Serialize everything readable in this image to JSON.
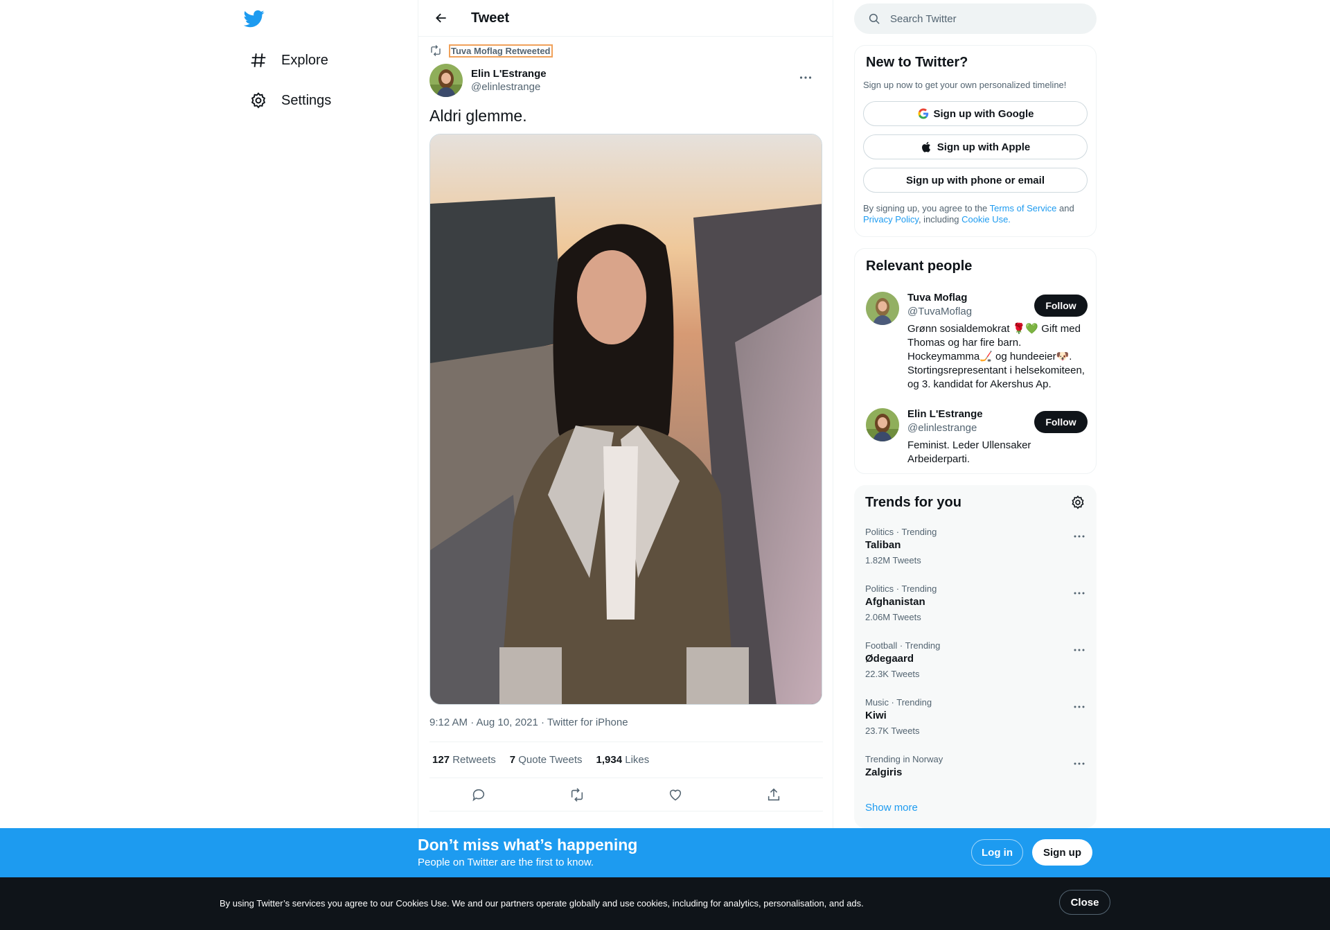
{
  "colors": {
    "accent": "#1d9bf0",
    "text": "#0f1419",
    "muted": "#536471",
    "dark_bar": "#0f1419"
  },
  "nav": {
    "logo_icon": "twitter-bird-icon",
    "items": [
      {
        "label": "Explore",
        "icon": "hashtag-icon"
      },
      {
        "label": "Settings",
        "icon": "gear-icon"
      }
    ]
  },
  "header": {
    "title": "Tweet",
    "back_icon": "arrow-left-icon"
  },
  "tweet": {
    "retweeted_by": "Tuva Moflag Retweeted",
    "author_name": "Elin L'Estrange",
    "author_handle": "@elinlestrange",
    "text": "Aldri glemme.",
    "meta": "9:12 AM · Aug 10, 2021 · Twitter for iPhone",
    "stats": [
      {
        "count": "127",
        "label": "Retweets"
      },
      {
        "count": "7",
        "label": "Quote Tweets"
      },
      {
        "count": "1,934",
        "label": "Likes"
      }
    ]
  },
  "search": {
    "placeholder": "Search Twitter"
  },
  "signup_card": {
    "title": "New to Twitter?",
    "subtitle": "Sign up now to get your own personalized timeline!",
    "google_label": "Sign up with Google",
    "apple_label": "Sign up with Apple",
    "phone_label": "Sign up with phone or email",
    "legal_prefix": "By signing up, you agree to the ",
    "terms": "Terms of Service",
    "and": " and ",
    "privacy": "Privacy Policy",
    "including": ", including ",
    "cookie_use": "Cookie Use."
  },
  "people": {
    "title": "Relevant people",
    "list": [
      {
        "name": "Tuva Moflag",
        "handle": "@TuvaMoflag",
        "bio": "Grønn sosialdemokrat 🌹💚 Gift med Thomas og har fire barn. Hockeymamma🏒 og hundeeier🐶. Stortingsrepresentant i helsekomiteen, og 3. kandidat for Akershus Ap.",
        "follow": "Follow"
      },
      {
        "name": "Elin L'Estrange",
        "handle": "@elinlestrange",
        "bio": "Feminist. Leder Ullensaker Arbeiderparti.",
        "follow": "Follow"
      }
    ]
  },
  "trends": {
    "title": "Trends for you",
    "items": [
      {
        "meta": "Politics · Trending",
        "name": "Taliban",
        "count": "1.82M Tweets"
      },
      {
        "meta": "Politics · Trending",
        "name": "Afghanistan",
        "count": "2.06M Tweets"
      },
      {
        "meta": "Football · Trending",
        "name": "Ødegaard",
        "count": "22.3K Tweets"
      },
      {
        "meta": "Music · Trending",
        "name": "Kiwi",
        "count": "23.7K Tweets"
      },
      {
        "meta": "Trending in Norway",
        "name": "Zalgiris",
        "count": ""
      }
    ],
    "show_more": "Show more"
  },
  "promo": {
    "title": "Don’t miss what’s happening",
    "subtitle": "People on Twitter are the first to know.",
    "login": "Log in",
    "signup": "Sign up"
  },
  "cookie_bar": {
    "text": "By using Twitter’s services you agree to our Cookies Use. We and our partners operate globally and use cookies, including for analytics, personalisation, and ads.",
    "close": "Close"
  }
}
